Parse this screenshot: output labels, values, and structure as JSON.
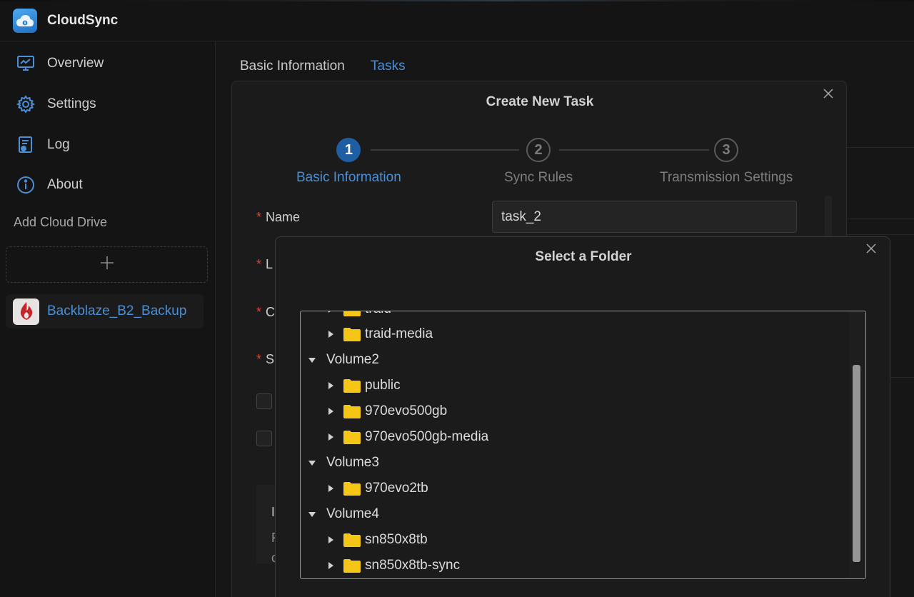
{
  "app": {
    "title": "CloudSync"
  },
  "sidebar": {
    "items": [
      {
        "label": "Overview",
        "icon": "monitor-chart-icon"
      },
      {
        "label": "Settings",
        "icon": "gear-icon"
      },
      {
        "label": "Log",
        "icon": "log-icon"
      },
      {
        "label": "About",
        "icon": "info-icon"
      }
    ],
    "section_label": "Add Cloud Drive",
    "drives": [
      {
        "label": "Backblaze_B2_Backup",
        "icon": "backblaze-flame-icon"
      }
    ]
  },
  "main": {
    "tabs": [
      {
        "label": "Basic Information",
        "active": false
      },
      {
        "label": "Tasks",
        "active": true
      }
    ]
  },
  "task_modal": {
    "title": "Create New Task",
    "steps": [
      {
        "number": "1",
        "label": "Basic Information",
        "active": true
      },
      {
        "number": "2",
        "label": "Sync Rules",
        "active": false
      },
      {
        "number": "3",
        "label": "Transmission Settings",
        "active": false
      }
    ],
    "required_mark": "*",
    "fields": [
      {
        "label": "Name",
        "value": "task_2"
      },
      {
        "label": "L"
      },
      {
        "label": "C"
      },
      {
        "label": "S"
      }
    ],
    "hint_lines": [
      "I",
      "F",
      "c"
    ]
  },
  "folder_modal": {
    "title": "Select a Folder",
    "tree": [
      {
        "label": "traid",
        "type": "folder",
        "expanded": false
      },
      {
        "label": "traid-media",
        "type": "folder",
        "expanded": false
      },
      {
        "label": "Volume2",
        "type": "volume",
        "expanded": true
      },
      {
        "label": "public",
        "type": "folder",
        "expanded": false
      },
      {
        "label": "970evo500gb",
        "type": "folder",
        "expanded": false
      },
      {
        "label": "970evo500gb-media",
        "type": "folder",
        "expanded": false
      },
      {
        "label": "Volume3",
        "type": "volume",
        "expanded": true
      },
      {
        "label": "970evo2tb",
        "type": "folder",
        "expanded": false
      },
      {
        "label": "Volume4",
        "type": "volume",
        "expanded": true
      },
      {
        "label": "sn850x8tb",
        "type": "folder",
        "expanded": false
      },
      {
        "label": "sn850x8tb-sync",
        "type": "folder",
        "expanded": false
      }
    ]
  },
  "colors": {
    "accent": "#4b8fd6",
    "step_active": "#1e5fa3",
    "required": "#d8453a",
    "folder": "#f5c518",
    "background": "#161616"
  }
}
